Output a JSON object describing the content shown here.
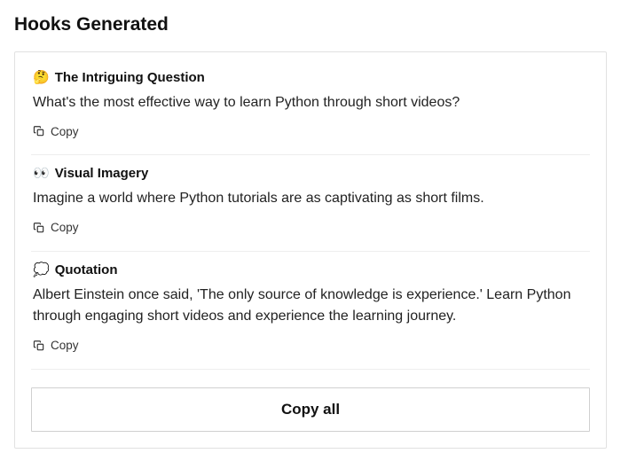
{
  "page_title": "Hooks Generated",
  "copy_label": "Copy",
  "copy_all_label": "Copy all",
  "hooks": [
    {
      "emoji": "🤔",
      "title": "The Intriguing Question",
      "body": "What's the most effective way to learn Python through short videos?"
    },
    {
      "emoji": "👀",
      "title": "Visual Imagery",
      "body": "Imagine a world where Python tutorials are as captivating as short films."
    },
    {
      "emoji": "💭",
      "title": "Quotation",
      "body": "Albert Einstein once said, 'The only source of knowledge is experience.' Learn Python through engaging short videos and experience the learning journey."
    }
  ]
}
